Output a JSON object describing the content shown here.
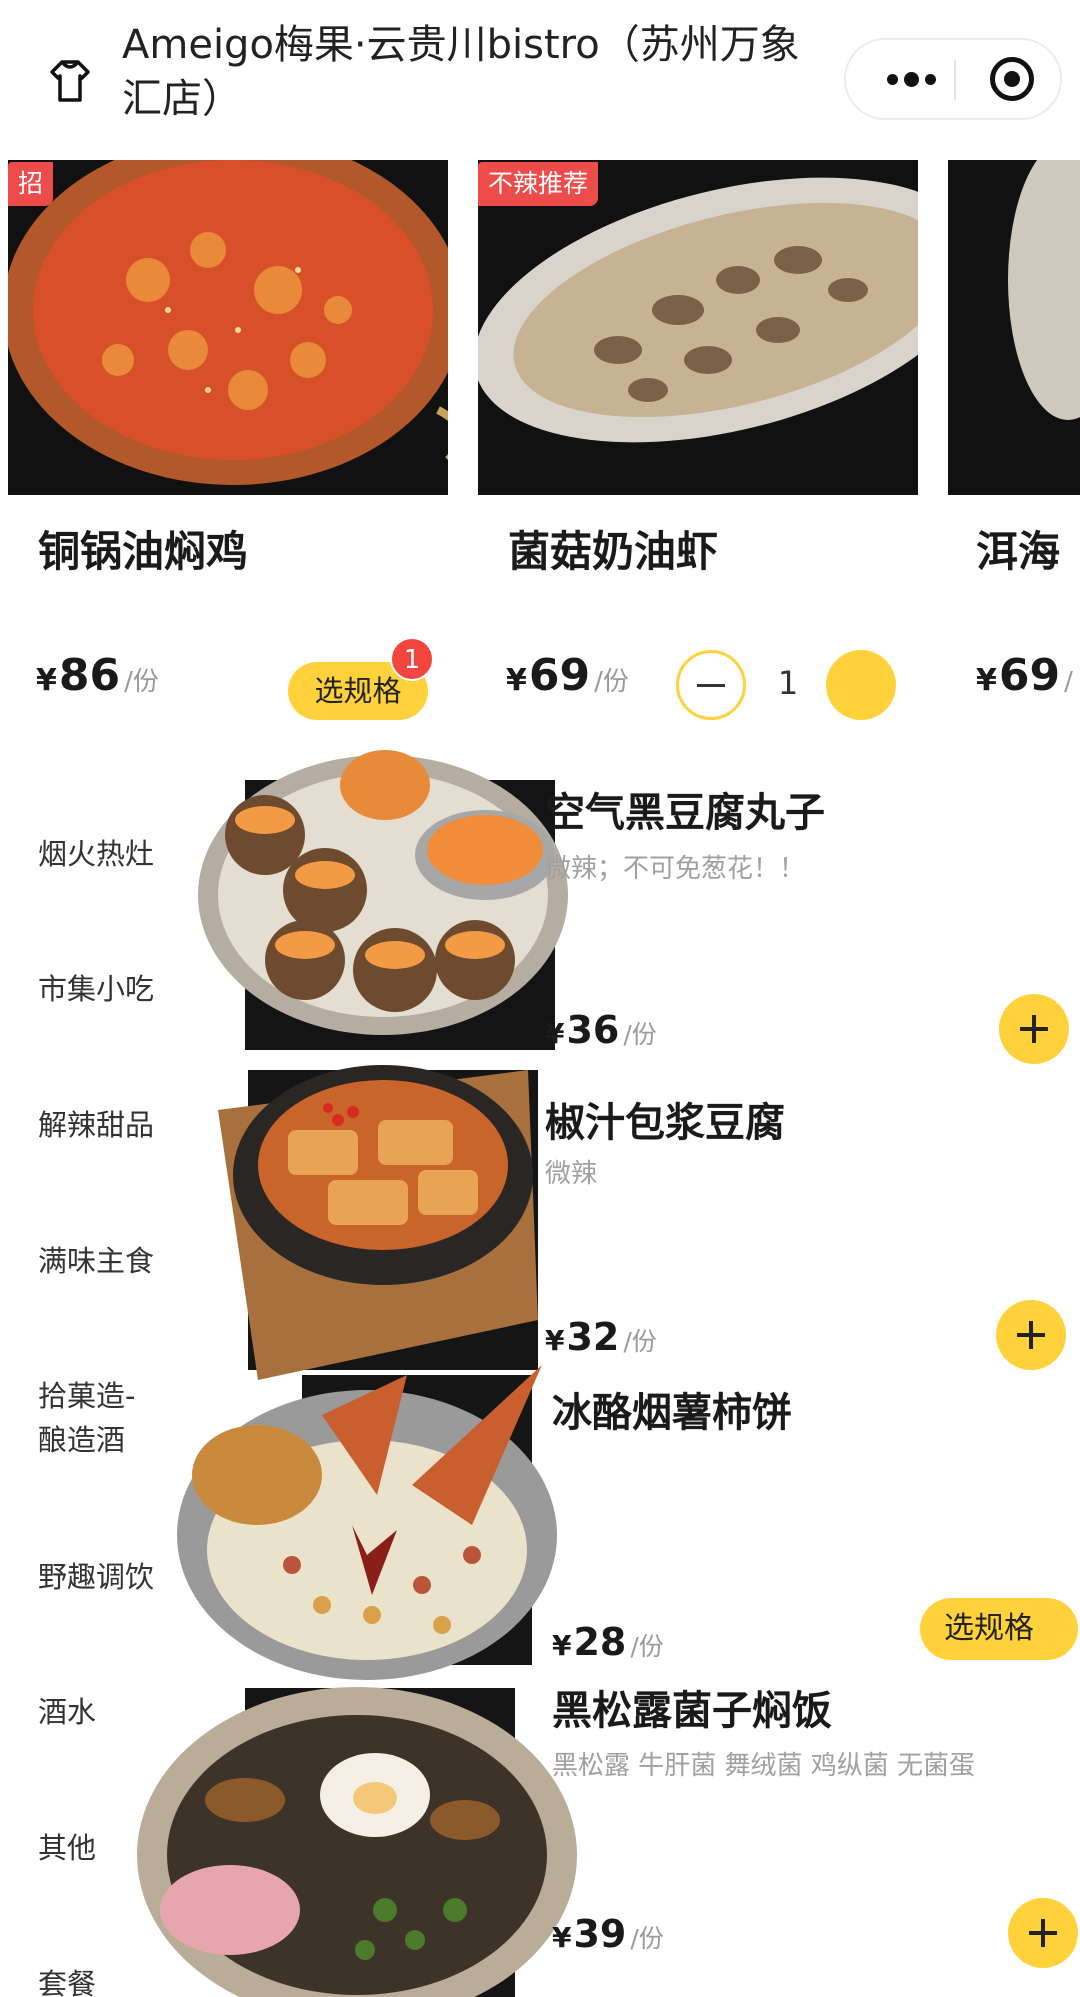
{
  "header": {
    "title": "Ameigo梅果·云贵川bistro（苏州万象汇店）"
  },
  "recommended": [
    {
      "tag": "招",
      "name": "铜锅油焖鸡",
      "currency": "¥",
      "price": "86",
      "unit": "/份",
      "action_label": "选规格",
      "badge_count": "1"
    },
    {
      "tag": "不辣推荐",
      "name": "菌菇奶油虾",
      "currency": "¥",
      "price": "69",
      "unit": "/份",
      "quantity": "1"
    },
    {
      "name": "洱海",
      "currency": "¥",
      "price": "69",
      "unit": "/"
    }
  ],
  "categories": [
    "烟火热灶",
    "市集小吃",
    "解辣甜品",
    "满味主食",
    "拾菓造-\n酿造酒",
    "野趣调饮",
    "酒水",
    "其他",
    "套餐"
  ],
  "products": [
    {
      "name": "空气黑豆腐丸子",
      "desc": "微辣；不可免葱花！！",
      "currency": "¥",
      "price": "36",
      "unit": "/份"
    },
    {
      "name": "椒汁包浆豆腐",
      "desc": "微辣",
      "currency": "¥",
      "price": "32",
      "unit": "/份"
    },
    {
      "name": "冰酪烟薯柿饼",
      "desc": "",
      "currency": "¥",
      "price": "28",
      "unit": "/份",
      "action_label": "选规格"
    },
    {
      "name": "黑松露菌子焖饭",
      "desc": "黑松露 牛肝菌 舞绒菌 鸡纵菌 无菌蛋",
      "currency": "¥",
      "price": "39",
      "unit": "/份"
    }
  ],
  "colors": {
    "accent": "#ffd23b",
    "tag": "#ee4b4b",
    "badge": "#f2453d"
  },
  "icons": [
    "home-icon",
    "more-icon",
    "target-icon",
    "minus-icon",
    "plus-icon"
  ]
}
